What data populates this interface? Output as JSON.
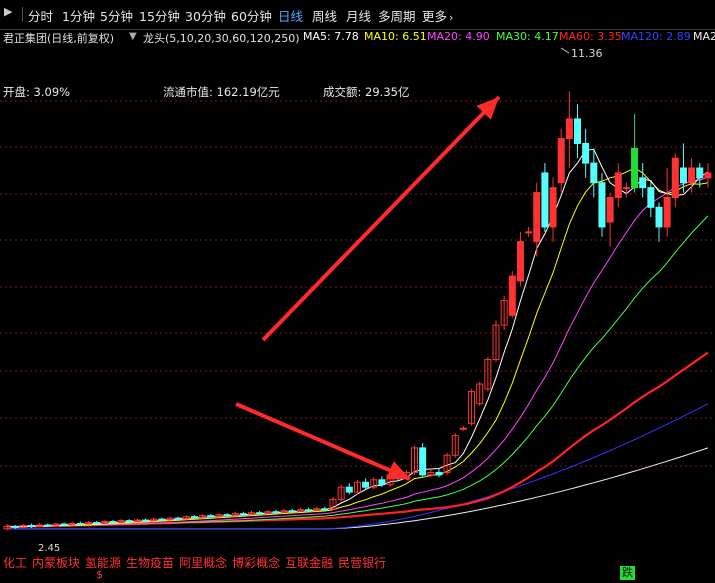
{
  "tabs": {
    "items": [
      "分时",
      "1分钟",
      "5分钟",
      "15分钟",
      "30分钟",
      "60分钟",
      "日线",
      "周线",
      "月线",
      "多周期",
      "更多"
    ],
    "active": "日线"
  },
  "ma_bar": {
    "stock_name": "君正集团(日线,前复权)",
    "indicator": "龙头(5,10,20,30,60,120,250)",
    "ma5": "MA5: 7.78",
    "ma10": "MA10: 6.51",
    "ma20": "MA20: 4.90",
    "ma30": "MA30: 4.17",
    "ma60": "MA60: 3.35",
    "ma120": "MA120: 2.89",
    "ma250": "MA2"
  },
  "colors": {
    "ma5": "#ffffff",
    "ma10": "#ffff00",
    "ma20": "#ff44ff",
    "ma30": "#44ff44",
    "ma60": "#ff2222",
    "ma120": "#3333ff",
    "ma250": "#f0f0f0",
    "up": "#ff3333",
    "down": "#55ffff",
    "arrow": "#ff2a2a",
    "grid": "#7a1a1a"
  },
  "info": {
    "open": "开盘: 3.09%",
    "market_cap": "流通市值: 162.19亿元",
    "volume": "成交额: 29.35亿"
  },
  "labels": {
    "high": "11.36",
    "low": "2.45"
  },
  "concepts": [
    "化工",
    "内蒙板块",
    "氢能源",
    "生物疫苗",
    "阿里概念",
    "博彩概念",
    "互联金融",
    "民营银行"
  ],
  "markers": {
    "dollar": "$",
    "die": "跌"
  },
  "chart_data": {
    "type": "candlestick",
    "title": "",
    "ylim": [
      2.0,
      12.0
    ],
    "candles": [
      {
        "o": 2.45,
        "c": 2.5,
        "h": 2.55,
        "l": 2.42
      },
      {
        "o": 2.5,
        "c": 2.48,
        "h": 2.53,
        "l": 2.45
      },
      {
        "o": 2.48,
        "c": 2.52,
        "h": 2.55,
        "l": 2.46
      },
      {
        "o": 2.52,
        "c": 2.5,
        "h": 2.56,
        "l": 2.47
      },
      {
        "o": 2.5,
        "c": 2.53,
        "h": 2.57,
        "l": 2.48
      },
      {
        "o": 2.53,
        "c": 2.51,
        "h": 2.56,
        "l": 2.49
      },
      {
        "o": 2.51,
        "c": 2.55,
        "h": 2.58,
        "l": 2.5
      },
      {
        "o": 2.55,
        "c": 2.53,
        "h": 2.58,
        "l": 2.51
      },
      {
        "o": 2.53,
        "c": 2.56,
        "h": 2.6,
        "l": 2.52
      },
      {
        "o": 2.56,
        "c": 2.55,
        "h": 2.6,
        "l": 2.53
      },
      {
        "o": 2.55,
        "c": 2.58,
        "h": 2.61,
        "l": 2.54
      },
      {
        "o": 2.58,
        "c": 2.56,
        "h": 2.61,
        "l": 2.55
      },
      {
        "o": 2.56,
        "c": 2.6,
        "h": 2.63,
        "l": 2.55
      },
      {
        "o": 2.6,
        "c": 2.58,
        "h": 2.63,
        "l": 2.56
      },
      {
        "o": 2.58,
        "c": 2.62,
        "h": 2.65,
        "l": 2.57
      },
      {
        "o": 2.62,
        "c": 2.6,
        "h": 2.65,
        "l": 2.58
      },
      {
        "o": 2.6,
        "c": 2.63,
        "h": 2.66,
        "l": 2.59
      },
      {
        "o": 2.63,
        "c": 2.62,
        "h": 2.66,
        "l": 2.6
      },
      {
        "o": 2.62,
        "c": 2.65,
        "h": 2.68,
        "l": 2.61
      },
      {
        "o": 2.65,
        "c": 2.64,
        "h": 2.68,
        "l": 2.62
      },
      {
        "o": 2.64,
        "c": 2.67,
        "h": 2.7,
        "l": 2.63
      },
      {
        "o": 2.67,
        "c": 2.66,
        "h": 2.7,
        "l": 2.64
      },
      {
        "o": 2.66,
        "c": 2.7,
        "h": 2.73,
        "l": 2.65
      },
      {
        "o": 2.7,
        "c": 2.68,
        "h": 2.73,
        "l": 2.66
      },
      {
        "o": 2.68,
        "c": 2.72,
        "h": 2.75,
        "l": 2.67
      },
      {
        "o": 2.72,
        "c": 2.7,
        "h": 2.75,
        "l": 2.68
      },
      {
        "o": 2.7,
        "c": 2.74,
        "h": 2.77,
        "l": 2.69
      },
      {
        "o": 2.74,
        "c": 2.72,
        "h": 2.77,
        "l": 2.7
      },
      {
        "o": 2.72,
        "c": 2.76,
        "h": 2.8,
        "l": 2.71
      },
      {
        "o": 2.76,
        "c": 2.75,
        "h": 2.8,
        "l": 2.73
      },
      {
        "o": 2.75,
        "c": 2.78,
        "h": 2.82,
        "l": 2.74
      },
      {
        "o": 2.78,
        "c": 2.77,
        "h": 2.82,
        "l": 2.75
      },
      {
        "o": 2.77,
        "c": 2.8,
        "h": 2.84,
        "l": 2.76
      },
      {
        "o": 2.8,
        "c": 2.79,
        "h": 2.84,
        "l": 2.77
      },
      {
        "o": 2.79,
        "c": 2.82,
        "h": 2.86,
        "l": 2.78
      },
      {
        "o": 2.82,
        "c": 2.81,
        "h": 2.86,
        "l": 2.79
      },
      {
        "o": 2.81,
        "c": 2.84,
        "h": 2.88,
        "l": 2.8
      },
      {
        "o": 2.84,
        "c": 2.83,
        "h": 2.88,
        "l": 2.81
      },
      {
        "o": 2.83,
        "c": 2.86,
        "h": 2.9,
        "l": 2.82
      },
      {
        "o": 2.86,
        "c": 2.85,
        "h": 2.9,
        "l": 2.83
      },
      {
        "o": 2.85,
        "c": 3.05,
        "h": 3.1,
        "l": 2.84
      },
      {
        "o": 3.05,
        "c": 3.3,
        "h": 3.35,
        "l": 3.0
      },
      {
        "o": 3.3,
        "c": 3.2,
        "h": 3.38,
        "l": 3.15
      },
      {
        "o": 3.2,
        "c": 3.4,
        "h": 3.45,
        "l": 3.15
      },
      {
        "o": 3.4,
        "c": 3.3,
        "h": 3.48,
        "l": 3.25
      },
      {
        "o": 3.3,
        "c": 3.45,
        "h": 3.5,
        "l": 3.25
      },
      {
        "o": 3.45,
        "c": 3.35,
        "h": 3.52,
        "l": 3.3
      },
      {
        "o": 3.35,
        "c": 3.55,
        "h": 3.6,
        "l": 3.3
      },
      {
        "o": 3.55,
        "c": 3.5,
        "h": 3.62,
        "l": 3.42
      },
      {
        "o": 3.5,
        "c": 3.6,
        "h": 3.65,
        "l": 3.45
      },
      {
        "o": 3.6,
        "c": 4.1,
        "h": 4.15,
        "l": 3.55
      },
      {
        "o": 4.1,
        "c": 3.55,
        "h": 4.2,
        "l": 3.5
      },
      {
        "o": 3.55,
        "c": 3.6,
        "h": 3.65,
        "l": 3.5
      },
      {
        "o": 3.6,
        "c": 3.55,
        "h": 3.68,
        "l": 3.5
      },
      {
        "o": 3.6,
        "c": 3.95,
        "h": 4.0,
        "l": 3.55
      },
      {
        "o": 3.95,
        "c": 4.35,
        "h": 4.4,
        "l": 3.9
      },
      {
        "o": 4.5,
        "c": 4.5,
        "h": 4.55,
        "l": 4.45
      },
      {
        "o": 4.6,
        "c": 5.25,
        "h": 5.3,
        "l": 4.55
      },
      {
        "o": 5.0,
        "c": 5.4,
        "h": 5.45,
        "l": 4.95
      },
      {
        "o": 5.3,
        "c": 5.9,
        "h": 5.95,
        "l": 5.25
      },
      {
        "o": 5.9,
        "c": 6.6,
        "h": 6.7,
        "l": 5.85
      },
      {
        "o": 6.6,
        "c": 7.1,
        "h": 7.2,
        "l": 6.5
      },
      {
        "o": 6.8,
        "c": 7.6,
        "h": 7.7,
        "l": 6.75
      },
      {
        "o": 7.5,
        "c": 8.3,
        "h": 8.5,
        "l": 7.4
      },
      {
        "o": 8.5,
        "c": 8.5,
        "h": 8.6,
        "l": 8.4
      },
      {
        "o": 8.3,
        "c": 9.3,
        "h": 9.5,
        "l": 8.0
      },
      {
        "o": 9.7,
        "c": 8.6,
        "h": 9.9,
        "l": 8.5
      },
      {
        "o": 8.6,
        "c": 9.4,
        "h": 9.6,
        "l": 8.3
      },
      {
        "o": 9.5,
        "c": 10.4,
        "h": 10.6,
        "l": 9.3
      },
      {
        "o": 10.4,
        "c": 10.8,
        "h": 11.36,
        "l": 9.8
      },
      {
        "o": 10.8,
        "c": 10.3,
        "h": 11.1,
        "l": 10.0
      },
      {
        "o": 10.3,
        "c": 9.9,
        "h": 10.6,
        "l": 9.6
      },
      {
        "o": 9.9,
        "c": 9.5,
        "h": 10.2,
        "l": 9.2
      },
      {
        "o": 9.5,
        "c": 8.6,
        "h": 9.7,
        "l": 8.4
      },
      {
        "o": 8.7,
        "c": 9.2,
        "h": 9.3,
        "l": 8.2
      },
      {
        "o": 9.2,
        "c": 9.7,
        "h": 9.9,
        "l": 9.0
      },
      {
        "o": 9.4,
        "c": 9.4,
        "h": 9.5,
        "l": 9.2
      },
      {
        "o": 9.4,
        "c": 10.2,
        "h": 10.9,
        "l": 9.3
      },
      {
        "o": 9.6,
        "c": 9.4,
        "h": 9.9,
        "l": 9.2
      },
      {
        "o": 9.4,
        "c": 9.0,
        "h": 9.5,
        "l": 8.8
      },
      {
        "o": 9.0,
        "c": 8.6,
        "h": 9.1,
        "l": 8.3
      },
      {
        "o": 8.6,
        "c": 9.2,
        "h": 9.8,
        "l": 8.4
      },
      {
        "o": 9.2,
        "c": 10.0,
        "h": 10.1,
        "l": 9.0
      },
      {
        "o": 9.8,
        "c": 9.5,
        "h": 10.3,
        "l": 9.3
      },
      {
        "o": 9.5,
        "c": 9.8,
        "h": 10.0,
        "l": 9.3
      },
      {
        "o": 9.8,
        "c": 9.6,
        "h": 9.9,
        "l": 9.4
      },
      {
        "o": 9.6,
        "c": 9.7,
        "h": 9.9,
        "l": 9.4
      }
    ]
  }
}
